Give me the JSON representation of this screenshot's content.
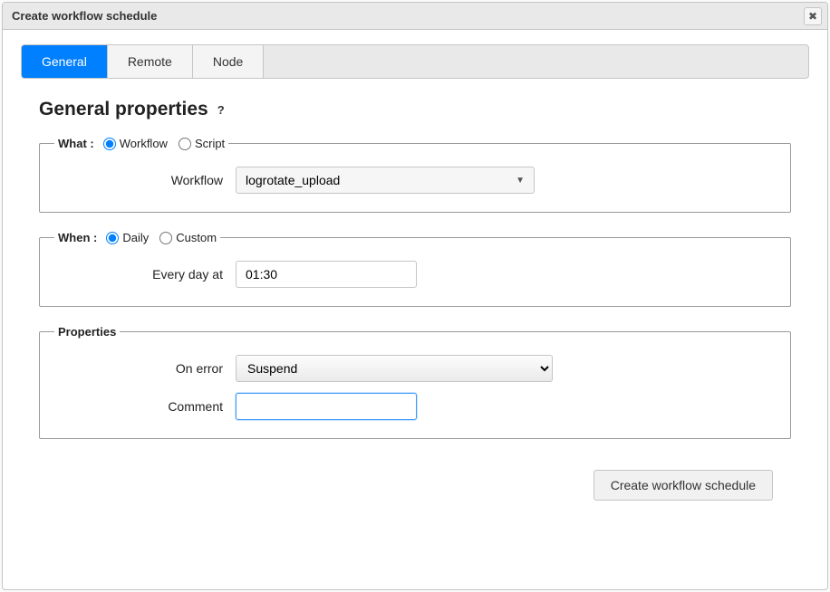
{
  "dialog": {
    "title": "Create workflow schedule"
  },
  "tabs": {
    "general": "General",
    "remote": "Remote",
    "node": "Node"
  },
  "section": {
    "title": "General properties"
  },
  "what": {
    "legend": "What :",
    "workflow_label": "Workflow",
    "script_label": "Script",
    "field_label": "Workflow",
    "field_value": "logrotate_upload"
  },
  "when": {
    "legend": "When :",
    "daily_label": "Daily",
    "custom_label": "Custom",
    "field_label": "Every day at",
    "field_value": "01:30"
  },
  "properties": {
    "legend": "Properties",
    "onerror_label": "On error",
    "onerror_value": "Suspend",
    "comment_label": "Comment",
    "comment_value": ""
  },
  "footer": {
    "submit_label": "Create workflow schedule"
  }
}
